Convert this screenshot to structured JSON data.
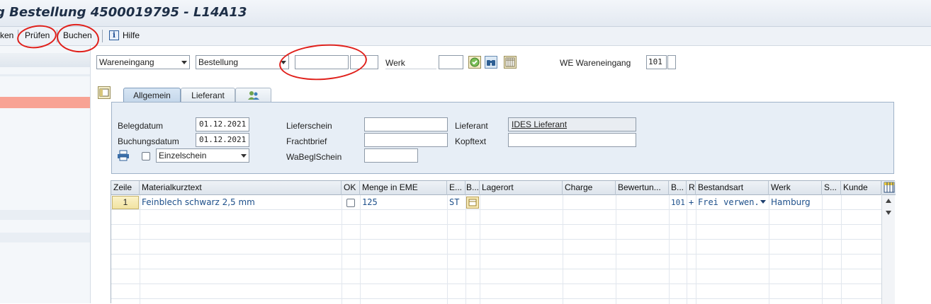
{
  "window": {
    "title": "g Bestellung 4500019795 - L14A13"
  },
  "toolbar": {
    "item_partial": "ken",
    "pruefen": "Prüfen",
    "buchen": "Buchen",
    "hilfe": "Hilfe"
  },
  "header": {
    "transaction_select": "Wareneingang",
    "reference_select": "Bestellung",
    "order_number": "",
    "order_item": "",
    "werk_label": "Werk",
    "werk_value": "",
    "movement_label": "WE Wareneingang",
    "movement_type": "101"
  },
  "tabs": [
    {
      "label": "Allgemein",
      "active": true
    },
    {
      "label": "Lieferant",
      "active": false
    },
    {
      "label": "",
      "icon": "partner-icon",
      "active": false
    }
  ],
  "general": {
    "belegdatum_label": "Belegdatum",
    "belegdatum": "01.12.2021",
    "buchungsdatum_label": "Buchungsdatum",
    "buchungsdatum": "01.12.2021",
    "print_option": "Einzelschein",
    "lieferschein_label": "Lieferschein",
    "lieferschein": "",
    "frachtbrief_label": "Frachtbrief",
    "frachtbrief": "",
    "wabegl_label": "WaBeglSchein",
    "wabegl": "",
    "lieferant_label": "Lieferant",
    "lieferant": "IDES Lieferant",
    "kopftext_label": "Kopftext",
    "kopftext": ""
  },
  "table": {
    "columns": [
      "Zeile",
      "Materialkurztext",
      "OK",
      "Menge in EME",
      "E...",
      "B...",
      "Lagerort",
      "Charge",
      "Bewertun...",
      "B...",
      "R",
      "Bestandsart",
      "Werk",
      "S...",
      "Kunde"
    ],
    "rows": [
      {
        "zeile": "1",
        "material": "Feinblech schwarz 2,5 mm",
        "ok": false,
        "menge": "125",
        "eme": "ST",
        "lagerort": "",
        "charge": "",
        "bewertung": "",
        "bwart": "101",
        "r": "+",
        "bestandsart": "Frei verwen...",
        "werk": "Hamburg",
        "s": "",
        "kunde": ""
      }
    ]
  },
  "colors": {
    "annotation": "#e0201b",
    "title": "#1e2f47",
    "value_text": "#1d4f8a",
    "highlight_band": "#f8a394"
  }
}
